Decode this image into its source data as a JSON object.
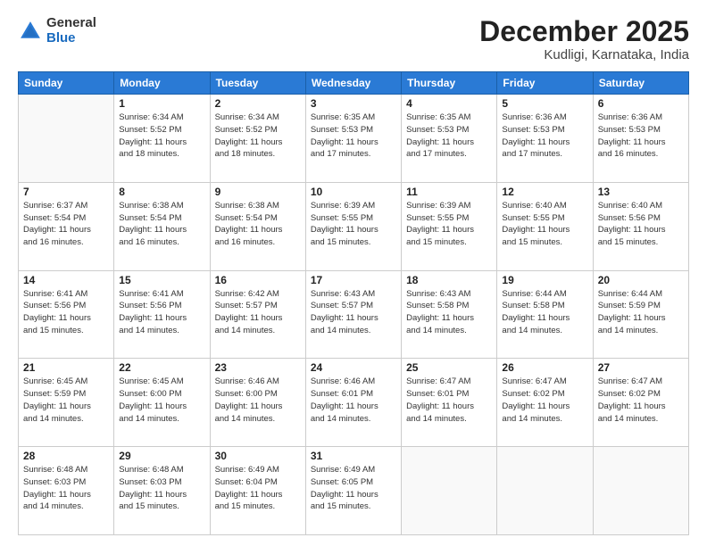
{
  "logo": {
    "general": "General",
    "blue": "Blue"
  },
  "header": {
    "month": "December 2025",
    "location": "Kudligi, Karnataka, India"
  },
  "days_of_week": [
    "Sunday",
    "Monday",
    "Tuesday",
    "Wednesday",
    "Thursday",
    "Friday",
    "Saturday"
  ],
  "weeks": [
    [
      {
        "day": "",
        "info": ""
      },
      {
        "day": "1",
        "info": "Sunrise: 6:34 AM\nSunset: 5:52 PM\nDaylight: 11 hours\nand 18 minutes."
      },
      {
        "day": "2",
        "info": "Sunrise: 6:34 AM\nSunset: 5:52 PM\nDaylight: 11 hours\nand 18 minutes."
      },
      {
        "day": "3",
        "info": "Sunrise: 6:35 AM\nSunset: 5:53 PM\nDaylight: 11 hours\nand 17 minutes."
      },
      {
        "day": "4",
        "info": "Sunrise: 6:35 AM\nSunset: 5:53 PM\nDaylight: 11 hours\nand 17 minutes."
      },
      {
        "day": "5",
        "info": "Sunrise: 6:36 AM\nSunset: 5:53 PM\nDaylight: 11 hours\nand 17 minutes."
      },
      {
        "day": "6",
        "info": "Sunrise: 6:36 AM\nSunset: 5:53 PM\nDaylight: 11 hours\nand 16 minutes."
      }
    ],
    [
      {
        "day": "7",
        "info": "Sunrise: 6:37 AM\nSunset: 5:54 PM\nDaylight: 11 hours\nand 16 minutes."
      },
      {
        "day": "8",
        "info": "Sunrise: 6:38 AM\nSunset: 5:54 PM\nDaylight: 11 hours\nand 16 minutes."
      },
      {
        "day": "9",
        "info": "Sunrise: 6:38 AM\nSunset: 5:54 PM\nDaylight: 11 hours\nand 16 minutes."
      },
      {
        "day": "10",
        "info": "Sunrise: 6:39 AM\nSunset: 5:55 PM\nDaylight: 11 hours\nand 15 minutes."
      },
      {
        "day": "11",
        "info": "Sunrise: 6:39 AM\nSunset: 5:55 PM\nDaylight: 11 hours\nand 15 minutes."
      },
      {
        "day": "12",
        "info": "Sunrise: 6:40 AM\nSunset: 5:55 PM\nDaylight: 11 hours\nand 15 minutes."
      },
      {
        "day": "13",
        "info": "Sunrise: 6:40 AM\nSunset: 5:56 PM\nDaylight: 11 hours\nand 15 minutes."
      }
    ],
    [
      {
        "day": "14",
        "info": "Sunrise: 6:41 AM\nSunset: 5:56 PM\nDaylight: 11 hours\nand 15 minutes."
      },
      {
        "day": "15",
        "info": "Sunrise: 6:41 AM\nSunset: 5:56 PM\nDaylight: 11 hours\nand 14 minutes."
      },
      {
        "day": "16",
        "info": "Sunrise: 6:42 AM\nSunset: 5:57 PM\nDaylight: 11 hours\nand 14 minutes."
      },
      {
        "day": "17",
        "info": "Sunrise: 6:43 AM\nSunset: 5:57 PM\nDaylight: 11 hours\nand 14 minutes."
      },
      {
        "day": "18",
        "info": "Sunrise: 6:43 AM\nSunset: 5:58 PM\nDaylight: 11 hours\nand 14 minutes."
      },
      {
        "day": "19",
        "info": "Sunrise: 6:44 AM\nSunset: 5:58 PM\nDaylight: 11 hours\nand 14 minutes."
      },
      {
        "day": "20",
        "info": "Sunrise: 6:44 AM\nSunset: 5:59 PM\nDaylight: 11 hours\nand 14 minutes."
      }
    ],
    [
      {
        "day": "21",
        "info": "Sunrise: 6:45 AM\nSunset: 5:59 PM\nDaylight: 11 hours\nand 14 minutes."
      },
      {
        "day": "22",
        "info": "Sunrise: 6:45 AM\nSunset: 6:00 PM\nDaylight: 11 hours\nand 14 minutes."
      },
      {
        "day": "23",
        "info": "Sunrise: 6:46 AM\nSunset: 6:00 PM\nDaylight: 11 hours\nand 14 minutes."
      },
      {
        "day": "24",
        "info": "Sunrise: 6:46 AM\nSunset: 6:01 PM\nDaylight: 11 hours\nand 14 minutes."
      },
      {
        "day": "25",
        "info": "Sunrise: 6:47 AM\nSunset: 6:01 PM\nDaylight: 11 hours\nand 14 minutes."
      },
      {
        "day": "26",
        "info": "Sunrise: 6:47 AM\nSunset: 6:02 PM\nDaylight: 11 hours\nand 14 minutes."
      },
      {
        "day": "27",
        "info": "Sunrise: 6:47 AM\nSunset: 6:02 PM\nDaylight: 11 hours\nand 14 minutes."
      }
    ],
    [
      {
        "day": "28",
        "info": "Sunrise: 6:48 AM\nSunset: 6:03 PM\nDaylight: 11 hours\nand 14 minutes."
      },
      {
        "day": "29",
        "info": "Sunrise: 6:48 AM\nSunset: 6:03 PM\nDaylight: 11 hours\nand 15 minutes."
      },
      {
        "day": "30",
        "info": "Sunrise: 6:49 AM\nSunset: 6:04 PM\nDaylight: 11 hours\nand 15 minutes."
      },
      {
        "day": "31",
        "info": "Sunrise: 6:49 AM\nSunset: 6:05 PM\nDaylight: 11 hours\nand 15 minutes."
      },
      {
        "day": "",
        "info": ""
      },
      {
        "day": "",
        "info": ""
      },
      {
        "day": "",
        "info": ""
      }
    ]
  ]
}
